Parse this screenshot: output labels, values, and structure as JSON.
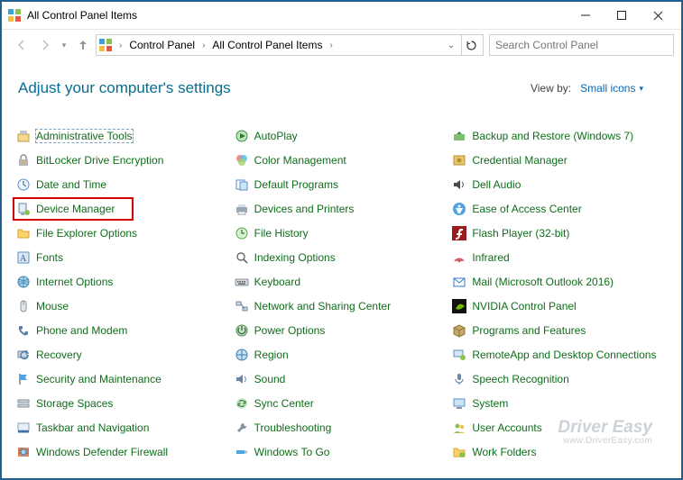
{
  "window": {
    "title": "All Control Panel Items"
  },
  "breadcrumb": {
    "seg1": "Control Panel",
    "seg2": "All Control Panel Items"
  },
  "search": {
    "placeholder": "Search Control Panel"
  },
  "header": {
    "title": "Adjust your computer's settings"
  },
  "viewby": {
    "label": "View by:",
    "value": "Small icons"
  },
  "cols": {
    "c1": {
      "i0": "Administrative Tools",
      "i1": "BitLocker Drive Encryption",
      "i2": "Date and Time",
      "i3": "Device Manager",
      "i4": "File Explorer Options",
      "i5": "Fonts",
      "i6": "Internet Options",
      "i7": "Mouse",
      "i8": "Phone and Modem",
      "i9": "Recovery",
      "i10": "Security and Maintenance",
      "i11": "Storage Spaces",
      "i12": "Taskbar and Navigation",
      "i13": "Windows Defender Firewall"
    },
    "c2": {
      "i0": "AutoPlay",
      "i1": "Color Management",
      "i2": "Default Programs",
      "i3": "Devices and Printers",
      "i4": "File History",
      "i5": "Indexing Options",
      "i6": "Keyboard",
      "i7": "Network and Sharing Center",
      "i8": "Power Options",
      "i9": "Region",
      "i10": "Sound",
      "i11": "Sync Center",
      "i12": "Troubleshooting",
      "i13": "Windows To Go"
    },
    "c3": {
      "i0": "Backup and Restore (Windows 7)",
      "i1": "Credential Manager",
      "i2": "Dell Audio",
      "i3": "Ease of Access Center",
      "i4": "Flash Player (32-bit)",
      "i5": "Infrared",
      "i6": "Mail (Microsoft Outlook 2016)",
      "i7": "NVIDIA Control Panel",
      "i8": "Programs and Features",
      "i9": "RemoteApp and Desktop Connections",
      "i10": "Speech Recognition",
      "i11": "System",
      "i12": "User Accounts",
      "i13": "Work Folders"
    }
  },
  "watermark": {
    "brand": "Driver Easy",
    "url": "www.DriverEasy.com"
  }
}
